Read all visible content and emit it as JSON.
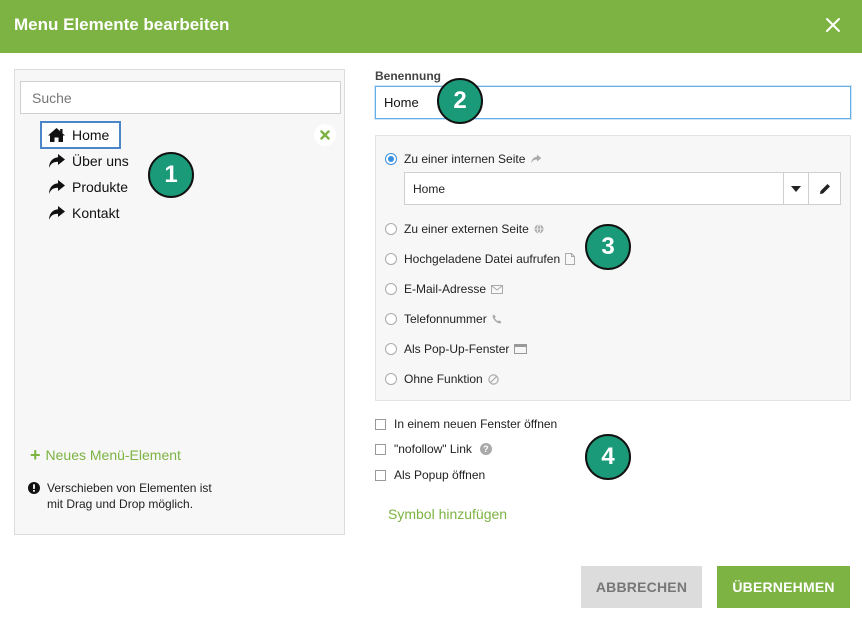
{
  "dialog": {
    "title": "Menu Elemente bearbeiten"
  },
  "left_panel": {
    "search_placeholder": "Suche",
    "items": [
      {
        "label": "Home",
        "icon": "home-icon",
        "active": true
      },
      {
        "label": "Über uns",
        "icon": "share-arrow-icon",
        "active": false
      },
      {
        "label": "Produkte",
        "icon": "share-arrow-icon",
        "active": false
      },
      {
        "label": "Kontakt",
        "icon": "share-arrow-icon",
        "active": false
      }
    ],
    "new_item_label": "Neues Menü-Element",
    "info_text": "Verschieben von Elementen ist mit Drag und Drop möglich."
  },
  "form": {
    "name_label": "Benennung",
    "name_value": "Home",
    "link_options": [
      {
        "label": "Zu einer internen Seite",
        "icon": "share-arrow-icon",
        "checked": true
      },
      {
        "label": "Zu einer externen Seite",
        "icon": "globe-icon",
        "checked": false
      },
      {
        "label": "Hochgeladene Datei aufrufen",
        "icon": "file-icon",
        "checked": false
      },
      {
        "label": "E-Mail-Adresse",
        "icon": "envelope-icon",
        "checked": false
      },
      {
        "label": "Telefonnummer",
        "icon": "phone-icon",
        "checked": false
      },
      {
        "label": "Als Pop-Up-Fenster",
        "icon": "window-icon",
        "checked": false
      },
      {
        "label": "Ohne Funktion",
        "icon": "ban-icon",
        "checked": false
      }
    ],
    "internal_page_selected": "Home",
    "checkboxes": [
      {
        "label": "In einem neuen Fenster öffnen",
        "checked": false
      },
      {
        "label": "\"nofollow\" Link",
        "checked": false,
        "help": true
      },
      {
        "label": "Als Popup öffnen",
        "checked": false
      }
    ],
    "add_symbol_label": "Symbol hinzufügen"
  },
  "buttons": {
    "cancel": "ABBRECHEN",
    "ok": "ÜBERNEHMEN"
  },
  "badges": [
    "1",
    "2",
    "3",
    "4"
  ],
  "colors": {
    "brand_green": "#7cb342",
    "badge_teal": "#1a9a78",
    "focus_blue": "#4a86c8",
    "radio_blue": "#3a8fe0"
  }
}
